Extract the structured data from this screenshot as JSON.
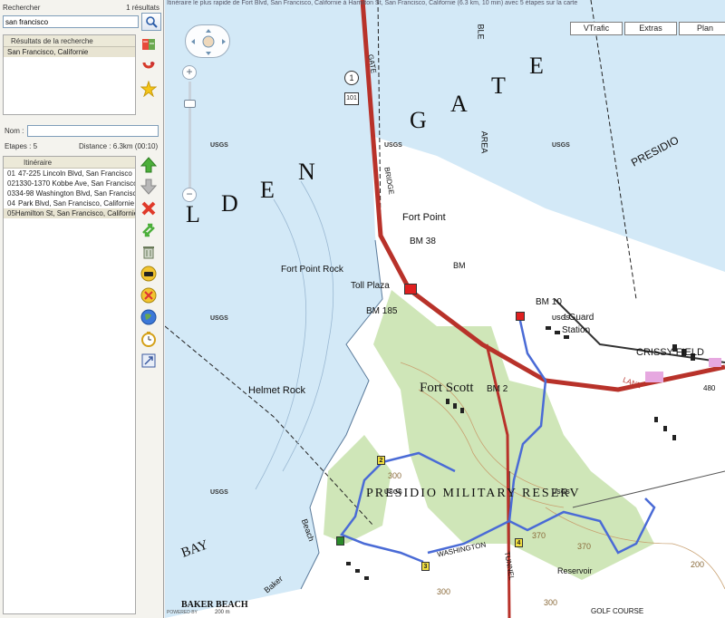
{
  "search": {
    "label": "Rechercher",
    "count": "1 résultats",
    "value": "san francisco",
    "results_header": "Résultats de la recherche",
    "results": [
      "San Francisco, Californie"
    ]
  },
  "route": {
    "name_label": "Nom :",
    "name_value": "",
    "steps_label": "Etapes : 5",
    "distance_label": "Distance : 6.3km (00:10)",
    "header": "Itinéraire",
    "items": [
      {
        "num": "01",
        "addr": "47-225 Lincoln Blvd, San Francisco"
      },
      {
        "num": "02",
        "addr": "1330-1370 Kobbe Ave, San Francisco"
      },
      {
        "num": "03",
        "addr": "34-98 Washington Blvd, San Francisco"
      },
      {
        "num": "04",
        "addr": "Park Blvd, San Francisco, Californie"
      },
      {
        "num": "05",
        "addr": "Hamilton St, San Francisco, Californie"
      }
    ]
  },
  "map": {
    "top_text": "Itinéraire le plus rapide de Fort Blvd, San Francisco, Californie à Hamilton St, San Francisco, Californie (6.3 km, 10 min) avec 5 étapes sur la carte",
    "buttons": [
      "VTrafic",
      "Extras",
      "Plan"
    ],
    "zoom_in": "+",
    "zoom_out": "−",
    "labels": {
      "golden_gate_l": "L",
      "golden_gate_d": "D",
      "golden_gate_e": "E",
      "golden_gate_n": "N",
      "gate_g": "G",
      "gate_a": "A",
      "gate_t": "T",
      "gate_e": "E",
      "presidio": "PRESIDIO",
      "area": "AREA",
      "ble": "BLE",
      "gate_road": "GATE",
      "bridge": "BRIDGE",
      "fort_point": "Fort Point",
      "bm38": "BM 38",
      "fort_point_rock": "Fort Point Rock",
      "toll_plaza": "Toll Plaza",
      "bm185": "BM 185",
      "bm10": "BM  10",
      "coast_guard": "t Guard",
      "station": "Station",
      "crissy_field": "CRISSY FIELD",
      "fort_scott": "Fort Scott",
      "bm_fs": "BM 2",
      "helmet_rock": "Helmet Rock",
      "presidio_military": "PRESIDIO  MILITARY  RESERV",
      "bay": "BAY",
      "baker_beach": "BAKER   BEACH",
      "baker": "Baker",
      "beach": "Beach",
      "washington": "WASHINGTON",
      "tunnel": "TUNNEL",
      "reservoir": "Reservoir",
      "bm_top": "BM",
      "lane": "LANE",
      "golf_course": "GOLF   COURSE",
      "hwy1": "1",
      "hwy101": "101",
      "usgs": "USGS",
      "num300a": "300",
      "num370": "370",
      "num200": "200",
      "num300b": "300",
      "num370b": "370",
      "num300c": "300",
      "num480": "480",
      "powered": "POWERED BY",
      "scale": "200 m"
    },
    "markers": [
      "2",
      "3",
      "4"
    ]
  },
  "colors": {
    "water": "#d3e9f7",
    "land": "#ffffff",
    "park": "#cfe6b8",
    "route_main": "#c0392b",
    "route_blue": "#4a6bd6"
  }
}
